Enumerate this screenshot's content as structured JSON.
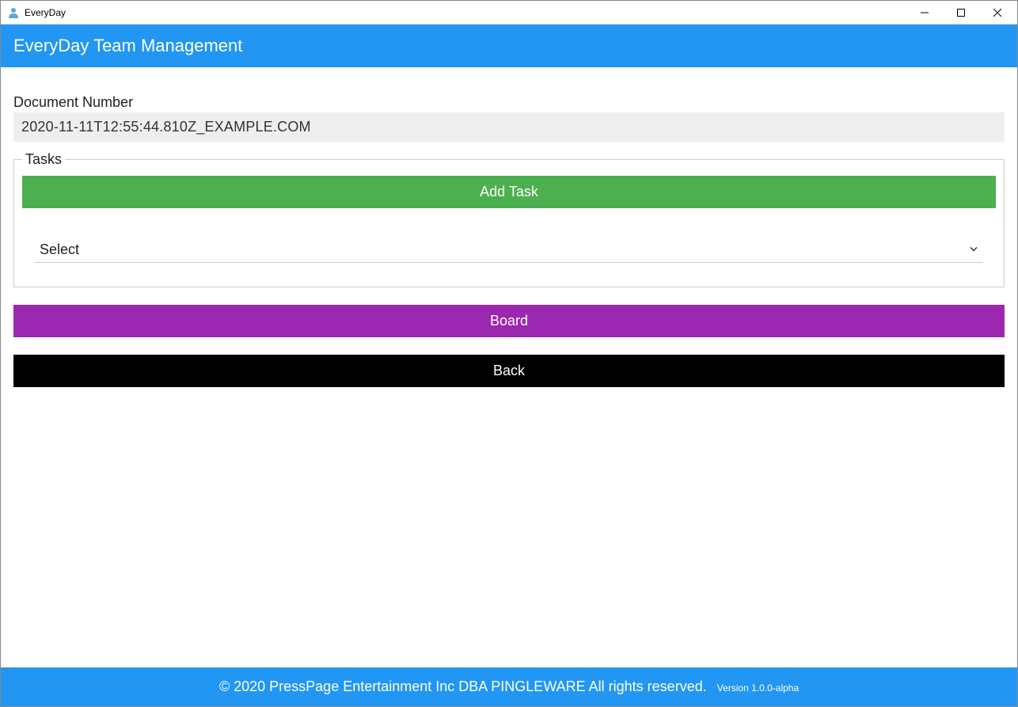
{
  "window": {
    "title": "EveryDay"
  },
  "header": {
    "title": "EveryDay Team Management"
  },
  "form": {
    "document_number_label": "Document Number",
    "document_number_value": "2020-11-11T12:55:44.810Z_EXAMPLE.COM",
    "tasks_legend": "Tasks",
    "add_task_label": "Add Task",
    "select_placeholder": "Select",
    "board_label": "Board",
    "back_label": "Back"
  },
  "footer": {
    "copyright": "© 2020 PressPage Entertainment Inc DBA PINGLEWARE  All rights reserved.",
    "version": "Version 1.0.0-alpha"
  }
}
